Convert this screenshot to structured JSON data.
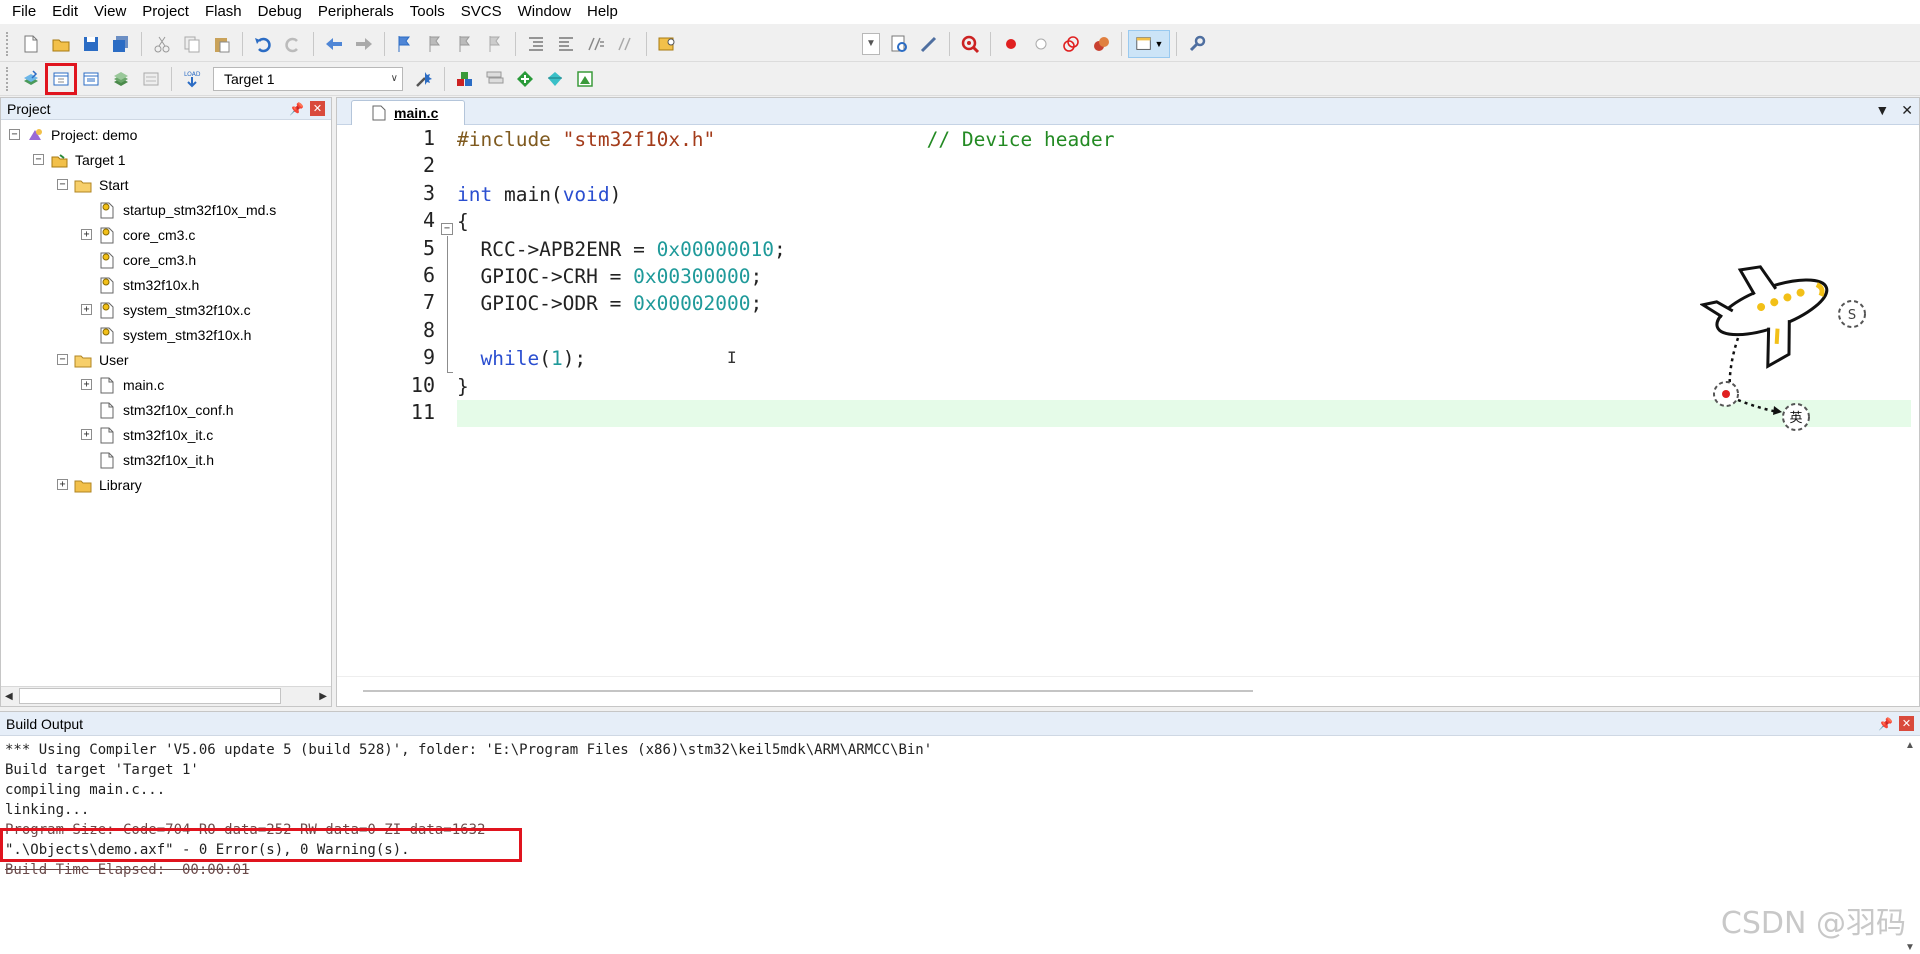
{
  "menubar": {
    "items": [
      "File",
      "Edit",
      "View",
      "Project",
      "Flash",
      "Debug",
      "Peripherals",
      "Tools",
      "SVCS",
      "Window",
      "Help"
    ]
  },
  "toolbar": {
    "target_select": "Target 1",
    "highlight_color": "#e0141e"
  },
  "project_panel": {
    "title": "Project",
    "tree": [
      {
        "label": "Project: demo",
        "level": 0,
        "expander": "minus",
        "icon": "project-icon"
      },
      {
        "label": "Target 1",
        "level": 1,
        "expander": "minus",
        "icon": "target-icon"
      },
      {
        "label": "Start",
        "level": 2,
        "expander": "minus",
        "icon": "folder-open-icon"
      },
      {
        "label": "startup_stm32f10x_md.s",
        "level": 3,
        "expander": "none",
        "icon": "file-key-icon"
      },
      {
        "label": "core_cm3.c",
        "level": 3,
        "expander": "plus",
        "icon": "file-key-icon"
      },
      {
        "label": "core_cm3.h",
        "level": 3,
        "expander": "none",
        "icon": "file-key-icon"
      },
      {
        "label": "stm32f10x.h",
        "level": 3,
        "expander": "none",
        "icon": "file-key-icon"
      },
      {
        "label": "system_stm32f10x.c",
        "level": 3,
        "expander": "plus",
        "icon": "file-key-icon"
      },
      {
        "label": "system_stm32f10x.h",
        "level": 3,
        "expander": "none",
        "icon": "file-key-icon"
      },
      {
        "label": "User",
        "level": 2,
        "expander": "minus",
        "icon": "folder-open-icon"
      },
      {
        "label": "main.c",
        "level": 3,
        "expander": "plus",
        "icon": "file-icon"
      },
      {
        "label": "stm32f10x_conf.h",
        "level": 3,
        "expander": "none",
        "icon": "file-icon"
      },
      {
        "label": "stm32f10x_it.c",
        "level": 3,
        "expander": "plus",
        "icon": "file-icon"
      },
      {
        "label": "stm32f10x_it.h",
        "level": 3,
        "expander": "none",
        "icon": "file-icon"
      },
      {
        "label": "Library",
        "level": 2,
        "expander": "plus",
        "icon": "folder-icon"
      }
    ]
  },
  "editor": {
    "tab_label": "main.c",
    "line_numbers": [
      "1",
      "2",
      "3",
      "4",
      "5",
      "6",
      "7",
      "8",
      "9",
      "10",
      "11"
    ],
    "lines": [
      [
        {
          "t": "#include ",
          "c": "pp"
        },
        {
          "t": "\"stm32f10x.h\"",
          "c": "str"
        },
        {
          "t": "                  ",
          "c": "plain"
        },
        {
          "t": "// Device header",
          "c": "cmt"
        }
      ],
      [],
      [
        {
          "t": "int",
          "c": "kw"
        },
        {
          "t": " main(",
          "c": "plain"
        },
        {
          "t": "void",
          "c": "kw"
        },
        {
          "t": ")",
          "c": "plain"
        }
      ],
      [
        {
          "t": "{",
          "c": "plain"
        }
      ],
      [
        {
          "t": "  RCC->APB2ENR = ",
          "c": "plain"
        },
        {
          "t": "0x00000010",
          "c": "num"
        },
        {
          "t": ";",
          "c": "plain"
        }
      ],
      [
        {
          "t": "  GPIOC->CRH = ",
          "c": "plain"
        },
        {
          "t": "0x00300000",
          "c": "num"
        },
        {
          "t": ";",
          "c": "plain"
        }
      ],
      [
        {
          "t": "  GPIOC->ODR = ",
          "c": "plain"
        },
        {
          "t": "0x00002000",
          "c": "num"
        },
        {
          "t": ";",
          "c": "plain"
        }
      ],
      [],
      [
        {
          "t": "  ",
          "c": "plain"
        },
        {
          "t": "while",
          "c": "kw"
        },
        {
          "t": "(",
          "c": "plain"
        },
        {
          "t": "1",
          "c": "num"
        },
        {
          "t": ");",
          "c": "plain"
        }
      ],
      [
        {
          "t": "}",
          "c": "plain"
        }
      ],
      []
    ],
    "current_line": 11,
    "airplane_badges": [
      "S",
      "英"
    ]
  },
  "build_output": {
    "title": "Build Output",
    "lines": [
      {
        "text": "*** Using Compiler 'V5.06 update 5 (build 528)', folder: 'E:\\Program Files (x86)\\stm32\\keil5mdk\\ARM\\ARMCC\\Bin'",
        "struck": false
      },
      {
        "text": "Build target 'Target 1'",
        "struck": false
      },
      {
        "text": "compiling main.c...",
        "struck": false
      },
      {
        "text": "linking...",
        "struck": false
      },
      {
        "text": "Program Size: Code=704 RO-data=252 RW-data=0 ZI-data=1632",
        "struck": true
      },
      {
        "text": "\".\\Objects\\demo.axf\" - 0 Error(s), 0 Warning(s).",
        "struck": false
      },
      {
        "text": "Build Time Elapsed:  00:00:01",
        "struck": true
      }
    ]
  },
  "watermark": "CSDN @羽码"
}
